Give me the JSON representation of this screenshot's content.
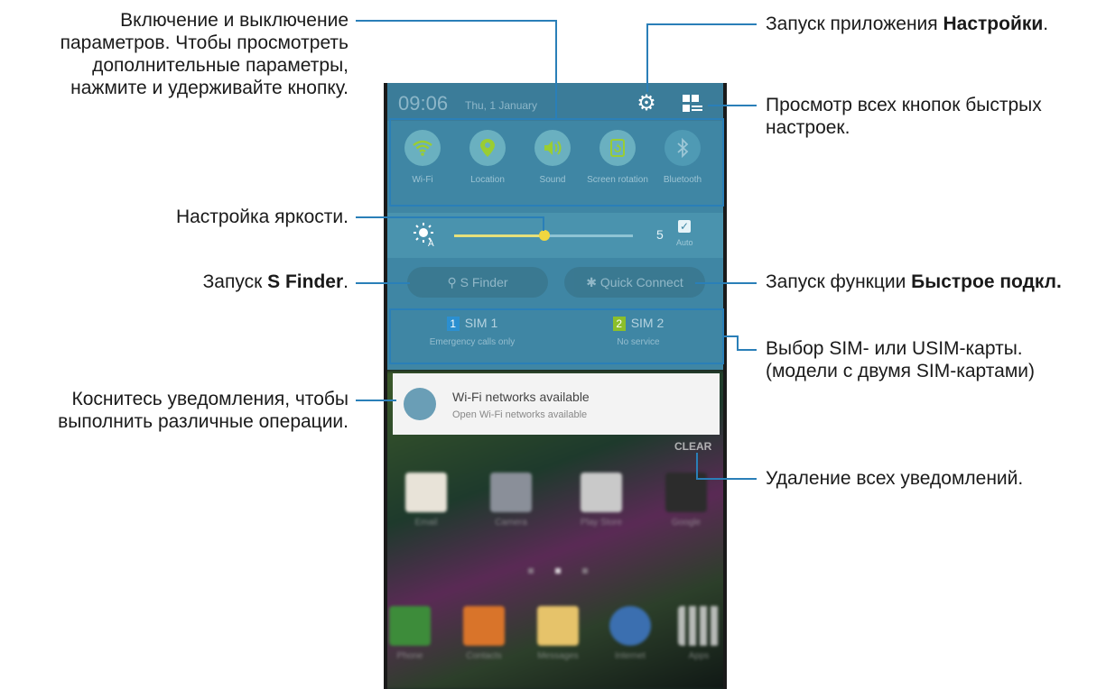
{
  "phone": {
    "status": {
      "time": "09:06",
      "date": "Thu, 1 January"
    },
    "quick_settings": [
      {
        "label": "Wi-Fi",
        "icon": "wifi-icon"
      },
      {
        "label": "Location",
        "icon": "location-icon"
      },
      {
        "label": "Sound",
        "icon": "sound-icon"
      },
      {
        "label": "Screen rotation",
        "icon": "rotation-icon"
      },
      {
        "label": "Bluetooth",
        "icon": "bluetooth-icon"
      }
    ],
    "brightness": {
      "level": "5",
      "auto_label": "Auto",
      "fraction": 0.5
    },
    "buttons": {
      "s_finder": "S Finder",
      "quick_connect": "Quick Connect"
    },
    "sims": [
      {
        "num": "1",
        "name": "SIM 1",
        "status": "Emergency calls only",
        "color": "#2b8fd0"
      },
      {
        "num": "2",
        "name": "SIM 2",
        "status": "No service",
        "color": "#8cbf2a"
      }
    ],
    "notification": {
      "title": "Wi-Fi networks available",
      "text": "Open Wi-Fi networks available"
    },
    "clear_label": "CLEAR",
    "apps_row1": [
      "Email",
      "Camera",
      "Play Store",
      "Google"
    ],
    "apps_row2": [
      "Phone",
      "Contacts",
      "Messages",
      "Internet",
      "Apps"
    ]
  },
  "callouts": {
    "toggle": "Включение и выключение параметров. Чтобы просмотреть дополнительные параметры, нажмите и удерживайте кнопку.",
    "toggle_lines": [
      "Включение и выключение",
      "параметров. Чтобы просмотреть",
      "дополнительные параметры,",
      "нажмите и удерживайте кнопку."
    ],
    "brightness": "Настройка яркости.",
    "sfinder_prefix": "Запуск ",
    "sfinder_bold": "S Finder",
    "sfinder_suffix": ".",
    "notif_lines": [
      "Коснитесь уведомления, чтобы",
      "выполнить различные операции."
    ],
    "settings_prefix": "Запуск приложения ",
    "settings_bold": "Настройки",
    "settings_suffix": ".",
    "all_buttons_lines": [
      "Просмотр всех кнопок быстрых",
      "настроек."
    ],
    "quick_connect_prefix": "Запуск функции ",
    "quick_connect_bold": "Быстрое подкл.",
    "sim_lines": [
      "Выбор SIM- или USIM-карты.",
      "(модели с двумя SIM-картами)"
    ],
    "clear_text": "Удаление всех уведомлений."
  },
  "colors": {
    "accent": "#2a7fb8",
    "panel": "#3f86a4",
    "toggle_on": "#9acd32"
  }
}
